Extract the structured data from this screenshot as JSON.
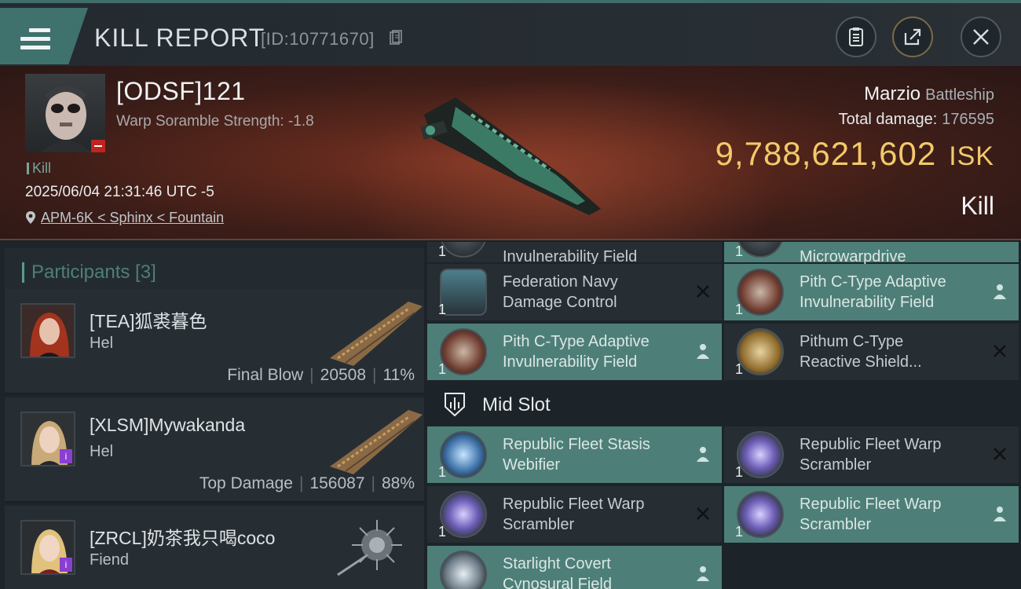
{
  "header": {
    "title": "KILL REPORT",
    "report_id": "[ID:10771670]"
  },
  "victim": {
    "name": "[ODSF]121",
    "warp_scramble": "Warp Soramble Strength: -1.8",
    "kill_tag": "Kill",
    "timestamp": "2025/06/04 21:31:46 UTC -5",
    "location": "APM-6K < Sphinx < Fountain",
    "ship_name": "Marzio",
    "ship_class": "Battleship",
    "total_damage_label": "Total damage:",
    "total_damage_value": "176595",
    "isk_value": "9,788,621,602",
    "isk_unit": "ISK",
    "result": "Kill"
  },
  "participants": {
    "label": "Participants [3]",
    "rows": [
      {
        "name": "[TEA]狐裘暮色",
        "ship": "Hel",
        "stat_label": "Final Blow",
        "damage": "20508",
        "percent": "11%"
      },
      {
        "name": "[XLSM]Mywakanda",
        "ship": "Hel",
        "stat_label": "Top Damage",
        "damage": "156087",
        "percent": "88%"
      },
      {
        "name": "[ZRCL]奶茶我只喝coco",
        "ship": "Fiend"
      }
    ]
  },
  "fitting": {
    "top_partial_left": "Invulnerability Field",
    "top_partial_right": "Microwarpdrive",
    "mid_slot_label": "Mid Slot",
    "slots": [
      {
        "qty": "1",
        "line1": "Federation Navy",
        "line2": "Damage Control",
        "state": "destroyed"
      },
      {
        "qty": "1",
        "line1": "Pith C-Type Adaptive",
        "line2": "Invulnerability Field",
        "state": "dropped"
      },
      {
        "qty": "1",
        "line1": "Pith C-Type Adaptive",
        "line2": "Invulnerability Field",
        "state": "dropped"
      },
      {
        "qty": "1",
        "line1": "Pithum C-Type",
        "line2": "Reactive Shield...",
        "state": "destroyed"
      },
      {
        "qty": "1",
        "line1": "Republic Fleet Stasis",
        "line2": "Webifier",
        "state": "dropped"
      },
      {
        "qty": "1",
        "line1": "Republic Fleet Warp",
        "line2": "Scrambler",
        "state": "destroyed"
      },
      {
        "qty": "1",
        "line1": "Republic Fleet Warp",
        "line2": "Scrambler",
        "state": "destroyed"
      },
      {
        "qty": "1",
        "line1": "Republic Fleet Warp",
        "line2": "Scrambler",
        "state": "dropped"
      },
      {
        "qty": "",
        "line1": "Starlight Covert",
        "line2": "Cynosural Field",
        "state": "dropped"
      }
    ]
  },
  "colors": {
    "accent": "#3f716d",
    "dropped_bg": "#4d7f78",
    "isk": "#f3c96a"
  }
}
